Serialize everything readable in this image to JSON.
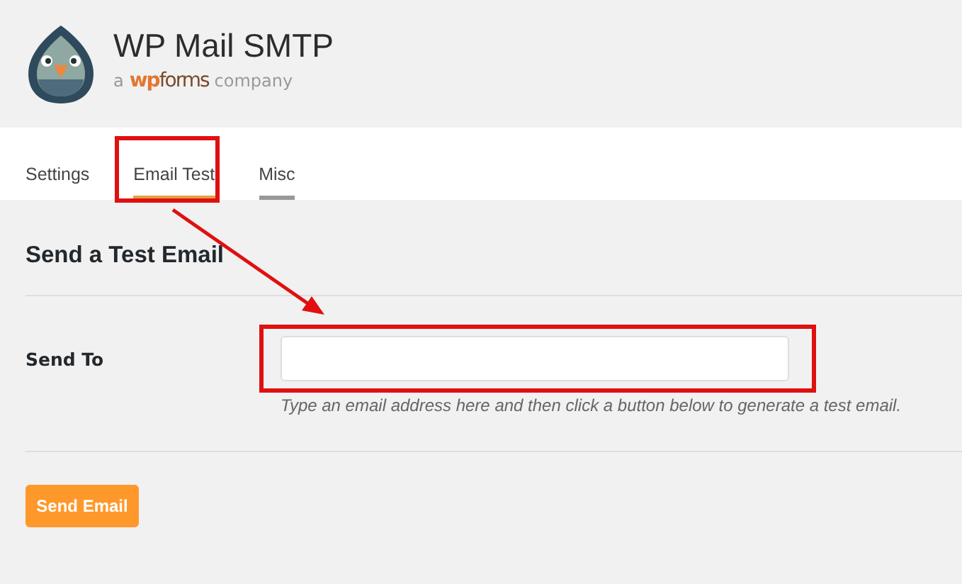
{
  "header": {
    "title": "WP Mail SMTP",
    "tagline_prefix": "a",
    "tagline_brand_wp": "wp",
    "tagline_brand_forms": "forms",
    "tagline_suffix": "company"
  },
  "tabs": [
    {
      "label": "Settings",
      "selected": false,
      "hovered": false
    },
    {
      "label": "Email Test",
      "selected": true,
      "hovered": false
    },
    {
      "label": "Misc",
      "selected": false,
      "hovered": true
    }
  ],
  "section": {
    "title": "Send a Test Email",
    "field": {
      "label": "Send To",
      "help": "Type an email address here and then click a button below to generate a test email."
    },
    "button": "Send Email"
  },
  "annotations": [
    {
      "kind": "frame"
    },
    {
      "kind": "frame"
    },
    {
      "kind": "arrow"
    }
  ]
}
